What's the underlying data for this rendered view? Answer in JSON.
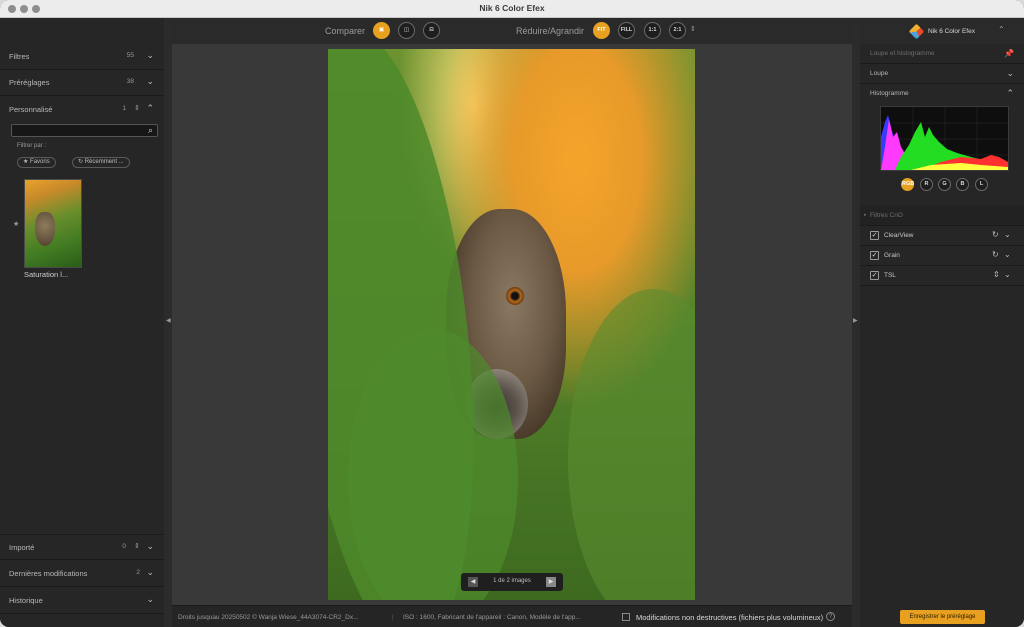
{
  "window": {
    "title": "Nik 6 Color Efex"
  },
  "left_panel": {
    "sections": [
      {
        "label": "Filtres",
        "count": "55"
      },
      {
        "label": "Préréglages",
        "count": "38"
      },
      {
        "label": "Personnalisé",
        "count": "1"
      }
    ],
    "search": {
      "placeholder": "",
      "value": ""
    },
    "filter_by_label": "Filtrer par :",
    "chips": [
      "★ Favoris",
      "↻ Récemment ..."
    ],
    "preset_thumb_label": "Saturation l...",
    "bottom_sections": [
      {
        "label": "Importé",
        "count": "0"
      },
      {
        "label": "Dernières modifications",
        "count": "2"
      },
      {
        "label": "Historique",
        "count": ""
      }
    ]
  },
  "toolbar": {
    "compare_label": "Comparer",
    "zoom_label": "Réduire/Agrandir",
    "zoom_buttons": [
      "FIT",
      "FILL",
      "1:1",
      "2:1"
    ]
  },
  "pager": {
    "text": "1 de 2 images"
  },
  "status": {
    "rights": "Droits jusquau 20250502 © Wanja Wiese_44A3074-CR2_Dx...",
    "exif": "ISO : 1600, Fabricant de l'appareil : Canon, Modèle de l'app...",
    "non_destructive": "Modifications non destructives (fichiers plus volumineux)"
  },
  "right_panel": {
    "title": "Nik 6 Color Efex",
    "loupe_hist_label": "Loupe et histogramme",
    "loupe_label": "Loupe",
    "histogram_label": "Histogramme",
    "channels": [
      "RGB",
      "R",
      "G",
      "B",
      "L"
    ],
    "filters_header": "Filtres CnO",
    "filters": [
      {
        "name": "ClearView"
      },
      {
        "name": "Grain"
      },
      {
        "name": "TSL"
      }
    ],
    "save_button": "Enregistrer le préréglage"
  },
  "colors": {
    "accent": "#e8a020",
    "panel": "#262626",
    "canvas": "#393939"
  }
}
